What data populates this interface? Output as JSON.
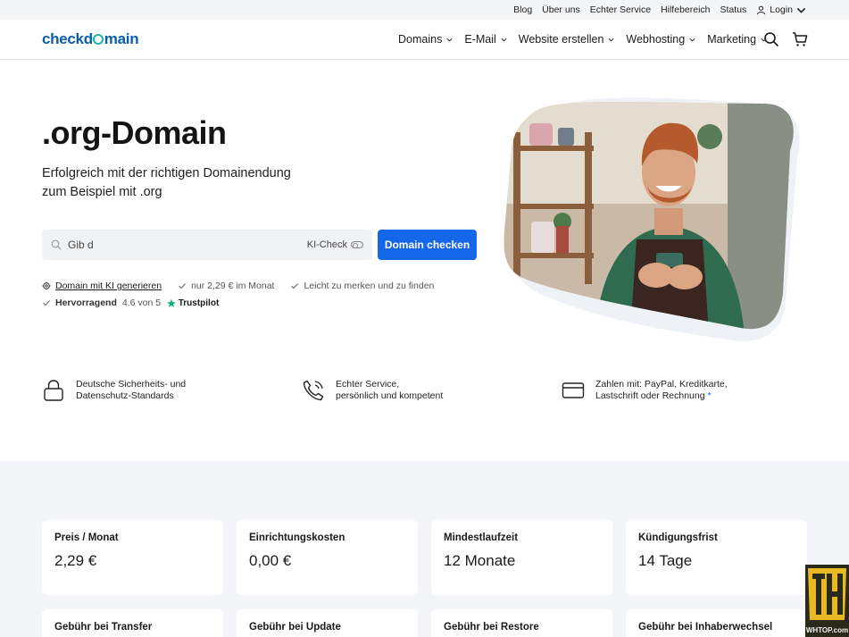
{
  "topbar": {
    "links": [
      "Blog",
      "Über uns",
      "Echter Service",
      "Hilfebereich",
      "Status"
    ],
    "login": "Login"
  },
  "nav": {
    "logo": {
      "part1": "checkd",
      "part2": "main"
    },
    "items": [
      "Domains",
      "E-Mail",
      "Website erstellen",
      "Webhosting",
      "Marketing"
    ]
  },
  "hero": {
    "title": ".org-Domain",
    "subtitle_line1": "Erfolgreich mit der richtigen Domainendung",
    "subtitle_line2": "zum Beispiel mit .org",
    "search_value": "Gib d",
    "ki_check": "KI-Check",
    "button": "Domain checken",
    "features": {
      "ki_link": "Domain mit KI generieren",
      "price": "nur 2,29 € im Monat",
      "easy": "Leicht zu merken und zu finden",
      "rating_word": "Hervorragend",
      "rating_value": "4.6 von 5",
      "trustpilot": "Trustpilot"
    }
  },
  "trust": [
    {
      "line1": "Deutsche Sicherheits- und",
      "line2": "Datenschutz-Standards",
      "icon": "lock-icon"
    },
    {
      "line1": "Echter Service,",
      "line2": "persönlich und kompetent",
      "icon": "phone-icon"
    },
    {
      "line1": "Zahlen mit: PayPal, Kreditkarte,",
      "line2": "Lastschrift oder Rechnung",
      "asterisk": "*",
      "icon": "credit-card-icon"
    }
  ],
  "cards": [
    {
      "label": "Preis / Monat",
      "value": "2,29 €"
    },
    {
      "label": "Einrichtungskosten",
      "value": "0,00 €"
    },
    {
      "label": "Mindestlaufzeit",
      "value": "12 Monate"
    },
    {
      "label": "Kündigungsfrist",
      "value": "14 Tage"
    },
    {
      "label": "Gebühr bei Transfer"
    },
    {
      "label": "Gebühr bei Update"
    },
    {
      "label": "Gebühr bei Restore"
    },
    {
      "label": "Gebühr bei Inhaberwechsel"
    }
  ],
  "badge": {
    "letters": "TH",
    "caption": "WHTOP.com"
  },
  "colors": {
    "primary": "#1467e8",
    "logo_blue": "#0b5ea8",
    "logo_teal": "#1ab3a6",
    "trustpilot_green": "#00b67a",
    "section_bg": "#f3f5f8"
  }
}
